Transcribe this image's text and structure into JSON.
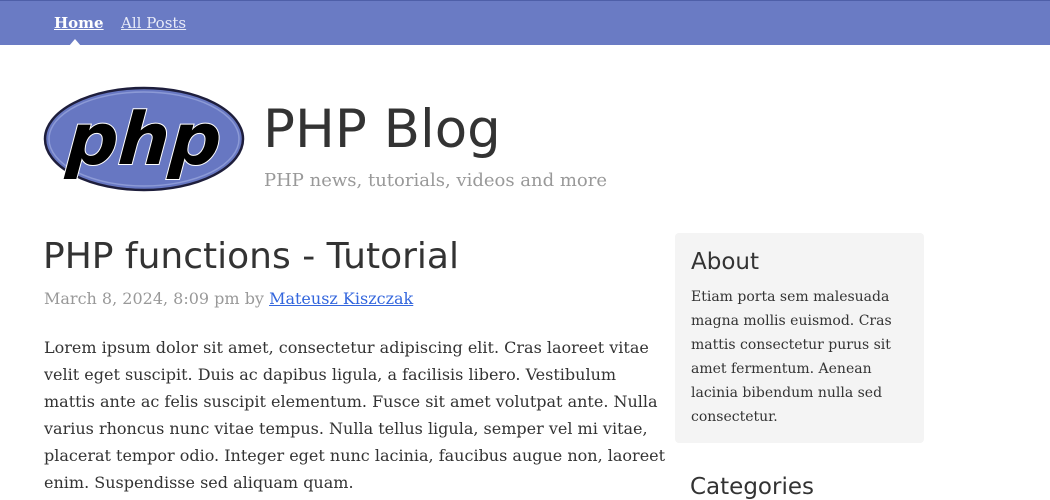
{
  "nav": {
    "items": [
      {
        "label": "Home",
        "active": true
      },
      {
        "label": "All Posts",
        "active": false
      }
    ],
    "background": "#6a7bc4"
  },
  "header": {
    "logo_text": "php",
    "title": "PHP Blog",
    "tagline": "PHP news, tutorials, videos and more"
  },
  "post": {
    "title": "PHP functions - Tutorial",
    "date": "March 8, 2024, 8:09 pm",
    "by_label": "by",
    "author": "Mateusz Kiszczak",
    "body": "Lorem ipsum dolor sit amet, consectetur adipiscing elit. Cras laoreet vitae velit eget suscipit. Duis ac dapibus ligula, a facilisis libero. Vestibulum mattis ante ac felis suscipit elementum. Fusce sit amet volutpat ante. Nulla varius rhoncus nunc vitae tempus. Nulla tellus ligula, semper vel mi vitae, placerat tempor odio. Integer eget nunc lacinia, faucibus augue non, laoreet enim. Suspendisse sed aliquam quam."
  },
  "sidebar": {
    "about_heading": "About",
    "about_text": "Etiam porta sem malesuada magna mollis euismod. Cras mattis consectetur purus sit amet fermentum. Aenean lacinia bibendum nulla sed consectetur.",
    "categories_heading": "Categories"
  },
  "colors": {
    "accent": "#6a7bc4",
    "link": "#3366dd",
    "muted": "#999999",
    "text": "#333333"
  }
}
